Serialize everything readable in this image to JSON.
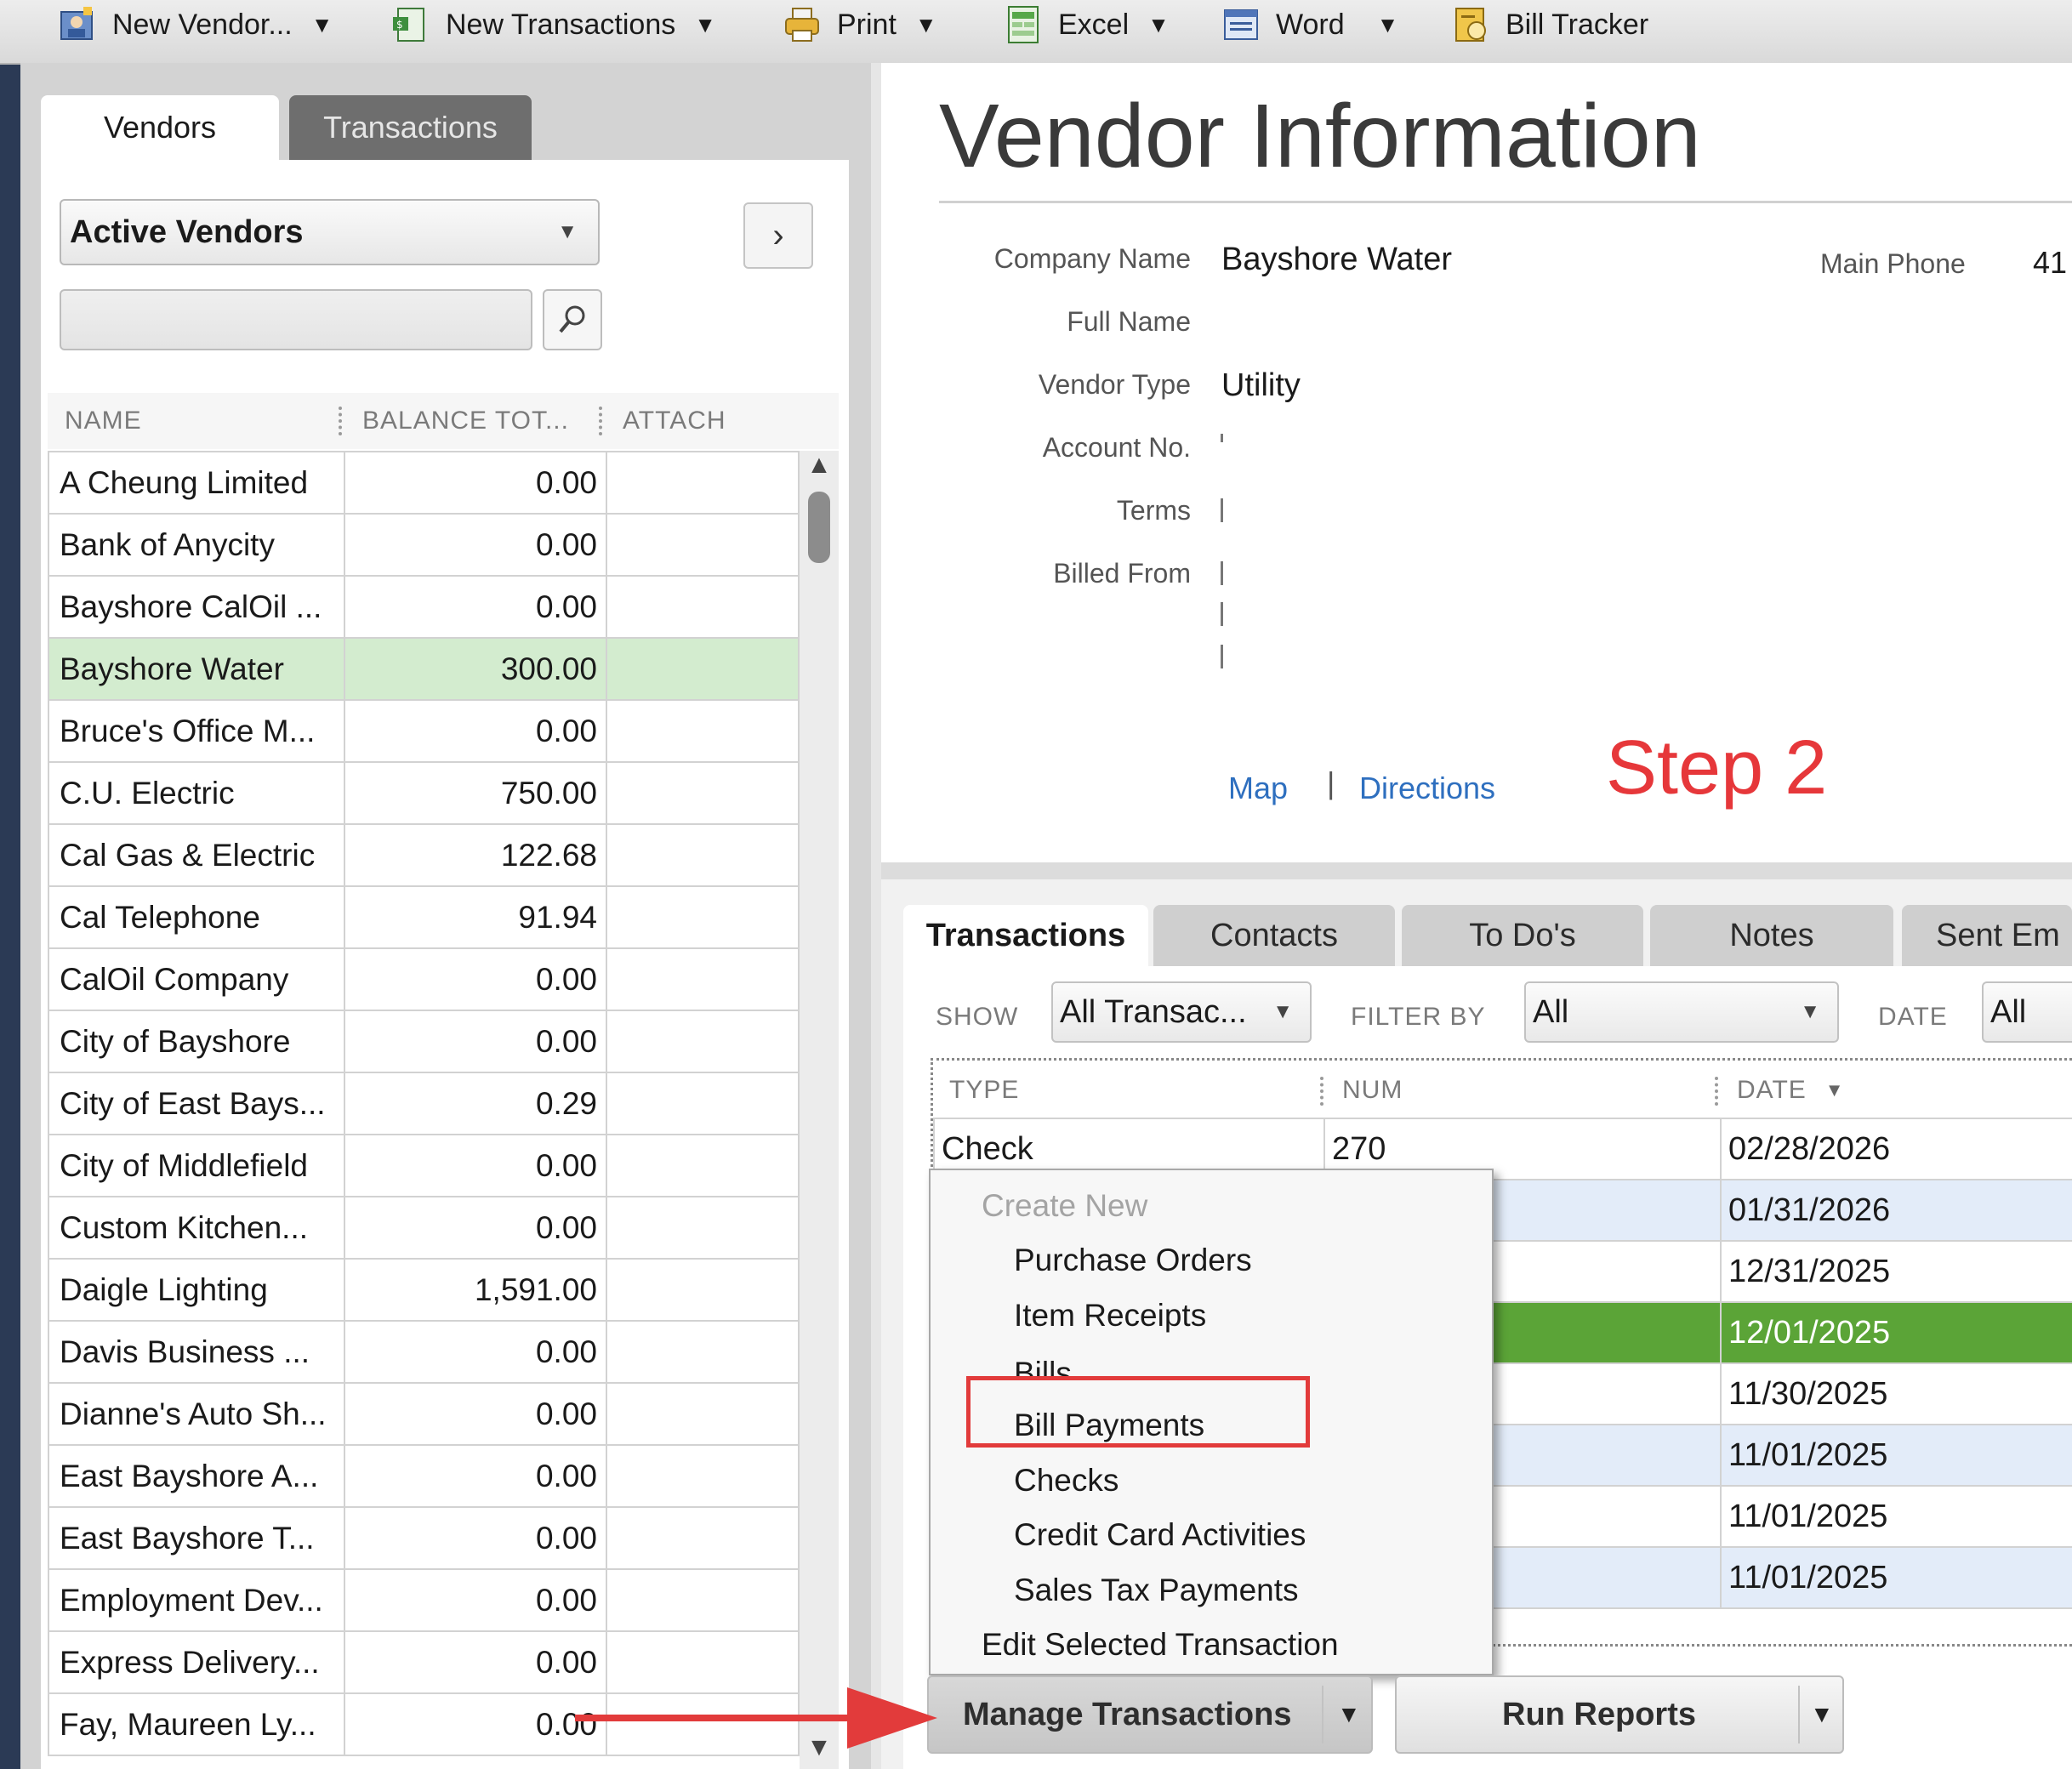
{
  "toolbar": {
    "items": [
      {
        "label": "New Vendor...",
        "icon": "new-vendor-icon",
        "has_caret": true
      },
      {
        "label": "New Transactions",
        "icon": "new-transactions-icon",
        "has_caret": true
      },
      {
        "label": "Print",
        "icon": "printer-icon",
        "has_caret": true
      },
      {
        "label": "Excel",
        "icon": "excel-icon",
        "has_caret": true
      },
      {
        "label": "Word",
        "icon": "word-icon",
        "has_caret": true
      },
      {
        "label": "Bill Tracker",
        "icon": "bill-tracker-icon",
        "has_caret": false
      }
    ],
    "caret": "▼"
  },
  "left_panel": {
    "tabs": [
      "Vendors",
      "Transactions"
    ],
    "filter": "Active Vendors",
    "search_value": "",
    "columns": [
      "NAME",
      "BALANCE TOT...",
      "ATTACH"
    ],
    "vendors": [
      {
        "name": "A Cheung Limited",
        "balance": "0.00"
      },
      {
        "name": "Bank of Anycity",
        "balance": "0.00"
      },
      {
        "name": "Bayshore CalOil ...",
        "balance": "0.00"
      },
      {
        "name": "Bayshore Water",
        "balance": "300.00"
      },
      {
        "name": "Bruce's Office M...",
        "balance": "0.00"
      },
      {
        "name": "C.U. Electric",
        "balance": "750.00"
      },
      {
        "name": "Cal Gas & Electric",
        "balance": "122.68"
      },
      {
        "name": "Cal Telephone",
        "balance": "91.94"
      },
      {
        "name": "CalOil Company",
        "balance": "0.00"
      },
      {
        "name": "City of Bayshore",
        "balance": "0.00"
      },
      {
        "name": "City of East Bays...",
        "balance": "0.29"
      },
      {
        "name": "City of Middlefield",
        "balance": "0.00"
      },
      {
        "name": "Custom Kitchen...",
        "balance": "0.00"
      },
      {
        "name": "Daigle Lighting",
        "balance": "1,591.00"
      },
      {
        "name": "Davis Business ...",
        "balance": "0.00"
      },
      {
        "name": "Dianne's Auto Sh...",
        "balance": "0.00"
      },
      {
        "name": "East Bayshore A...",
        "balance": "0.00"
      },
      {
        "name": "East Bayshore T...",
        "balance": "0.00"
      },
      {
        "name": "Employment Dev...",
        "balance": "0.00"
      },
      {
        "name": "Express Delivery...",
        "balance": "0.00"
      },
      {
        "name": "Fay, Maureen Ly...",
        "balance": "0.00"
      }
    ],
    "selected_vendor": "Bayshore Water"
  },
  "vendor_info": {
    "title": "Vendor Information",
    "fields": {
      "company_name_label": "Company Name",
      "company_name": "Bayshore Water",
      "full_name_label": "Full Name",
      "vendor_type_label": "Vendor Type",
      "vendor_type": "Utility",
      "account_no_label": "Account No.",
      "terms_label": "Terms",
      "billed_from_label": "Billed From",
      "main_phone_label": "Main Phone",
      "main_phone_partial": "41"
    },
    "map_link": "Map",
    "link_separator": "|",
    "directions_link": "Directions"
  },
  "annotation": {
    "step": "Step 2",
    "highlight_color": "#e23b3b"
  },
  "transactions_panel": {
    "tabs": [
      "Transactions",
      "Contacts",
      "To Do's",
      "Notes",
      "Sent Em"
    ],
    "show_label": "SHOW",
    "show_value": "All Transac...",
    "filter_label": "FILTER BY",
    "filter_value": "All",
    "date_label": "DATE",
    "date_value": "All",
    "columns": [
      "TYPE",
      "NUM",
      "DATE"
    ],
    "sort_indicator": "▼",
    "rows": [
      {
        "type": "Check",
        "num": "270",
        "date": "02/28/2026"
      },
      {
        "type": "",
        "num": "",
        "date": "01/31/2026"
      },
      {
        "type": "",
        "num": "",
        "date": "12/31/2025"
      },
      {
        "type": "",
        "num": "",
        "date": "12/01/2025"
      },
      {
        "type": "",
        "num": "",
        "date": "11/30/2025"
      },
      {
        "type": "",
        "num": "",
        "date": "11/01/2025"
      },
      {
        "type": "",
        "num": "",
        "date": "11/01/2025"
      },
      {
        "type": "",
        "num": "",
        "date": "11/01/2025"
      }
    ]
  },
  "dropdown_menu": {
    "header": "Create New",
    "items": [
      "Purchase Orders",
      "Item Receipts",
      "Bills",
      "Bill Payments",
      "Checks",
      "Credit Card Activities",
      "Sales Tax Payments"
    ],
    "footer_item": "Edit Selected Transaction",
    "highlighted_item": "Bill Payments"
  },
  "buttons": {
    "manage_transactions": "Manage Transactions",
    "run_reports": "Run Reports",
    "caret": "▼"
  },
  "colors": {
    "selected_row": "#d3eccf",
    "highlight_row": "#5ba437",
    "alt_row": "#e3ecf9",
    "link": "#2e6fbf",
    "annotation_red": "#e6373a"
  }
}
